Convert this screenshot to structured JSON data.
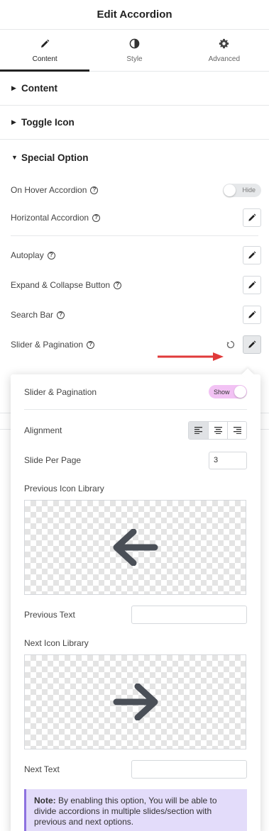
{
  "header": {
    "title": "Edit Accordion"
  },
  "tabs": [
    {
      "label": "Content",
      "icon": "pencil-icon",
      "active": true
    },
    {
      "label": "Style",
      "icon": "half-circle-icon",
      "active": false
    },
    {
      "label": "Advanced",
      "icon": "gear-icon",
      "active": false
    }
  ],
  "sections": {
    "content": "Content",
    "toggle_icon": "Toggle Icon",
    "special_option": "Special Option"
  },
  "special": {
    "on_hover": {
      "label": "On Hover Accordion",
      "toggle": "Hide"
    },
    "horizontal": {
      "label": "Horizontal Accordion"
    },
    "autoplay": {
      "label": "Autoplay"
    },
    "expand": {
      "label": "Expand & Collapse Button"
    },
    "search": {
      "label": "Search Bar"
    },
    "slider": {
      "label": "Slider & Pagination"
    }
  },
  "popover": {
    "slider_label": "Slider & Pagination",
    "slider_toggle": "Show",
    "alignment_label": "Alignment",
    "slide_per_page_label": "Slide Per Page",
    "slide_per_page_value": "3",
    "prev_icon_label": "Previous Icon Library",
    "prev_text_label": "Previous Text",
    "prev_text_value": "",
    "next_icon_label": "Next Icon Library",
    "next_text_label": "Next Text",
    "next_text_value": "",
    "note_bold": "Note:",
    "note_text": " By enabling this option, You will be able to divide accordions in multiple slides/section with previous and next options."
  },
  "colors": {
    "accent_pink": "#f2c2f4",
    "note_bg": "#e3dcfa",
    "note_border": "#8e72e0",
    "arrow_red": "#e03a3a",
    "icon_dark": "#4a4f57"
  }
}
